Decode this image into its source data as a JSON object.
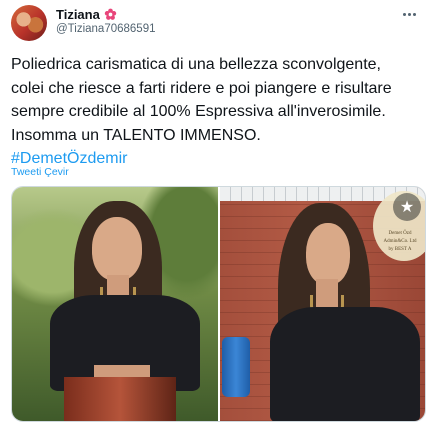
{
  "author": {
    "display_name": "Tiziana",
    "handle": "@Tiziana70686591",
    "verified_flower_icon": "flower-emoji-icon"
  },
  "menu": {
    "icon": "more-horizontal-icon"
  },
  "tweet": {
    "lines": [
      "Poliedrica carismatica di una bellezza sconvolgente,",
      "colei che riesce a farti ridere e poi piangere e  risultare",
      "sempre credibile al 100% Espressiva all'inverosimile.",
      "Insomma un TALENTO IMMENSO."
    ],
    "hashtag": "#DemetÖzdemir",
    "translate_label": "Tweeti Çevir"
  },
  "media": {
    "photos": [
      "photo-1",
      "photo-2"
    ],
    "watermark": {
      "line1": "Demet Özd",
      "line2": "Admin&Co. Ltd",
      "line3": "by BEST A"
    },
    "star_icon": "star-icon"
  },
  "colors": {
    "link": "#1d9bf0",
    "text": "#0f1419",
    "secondary": "#536471"
  }
}
